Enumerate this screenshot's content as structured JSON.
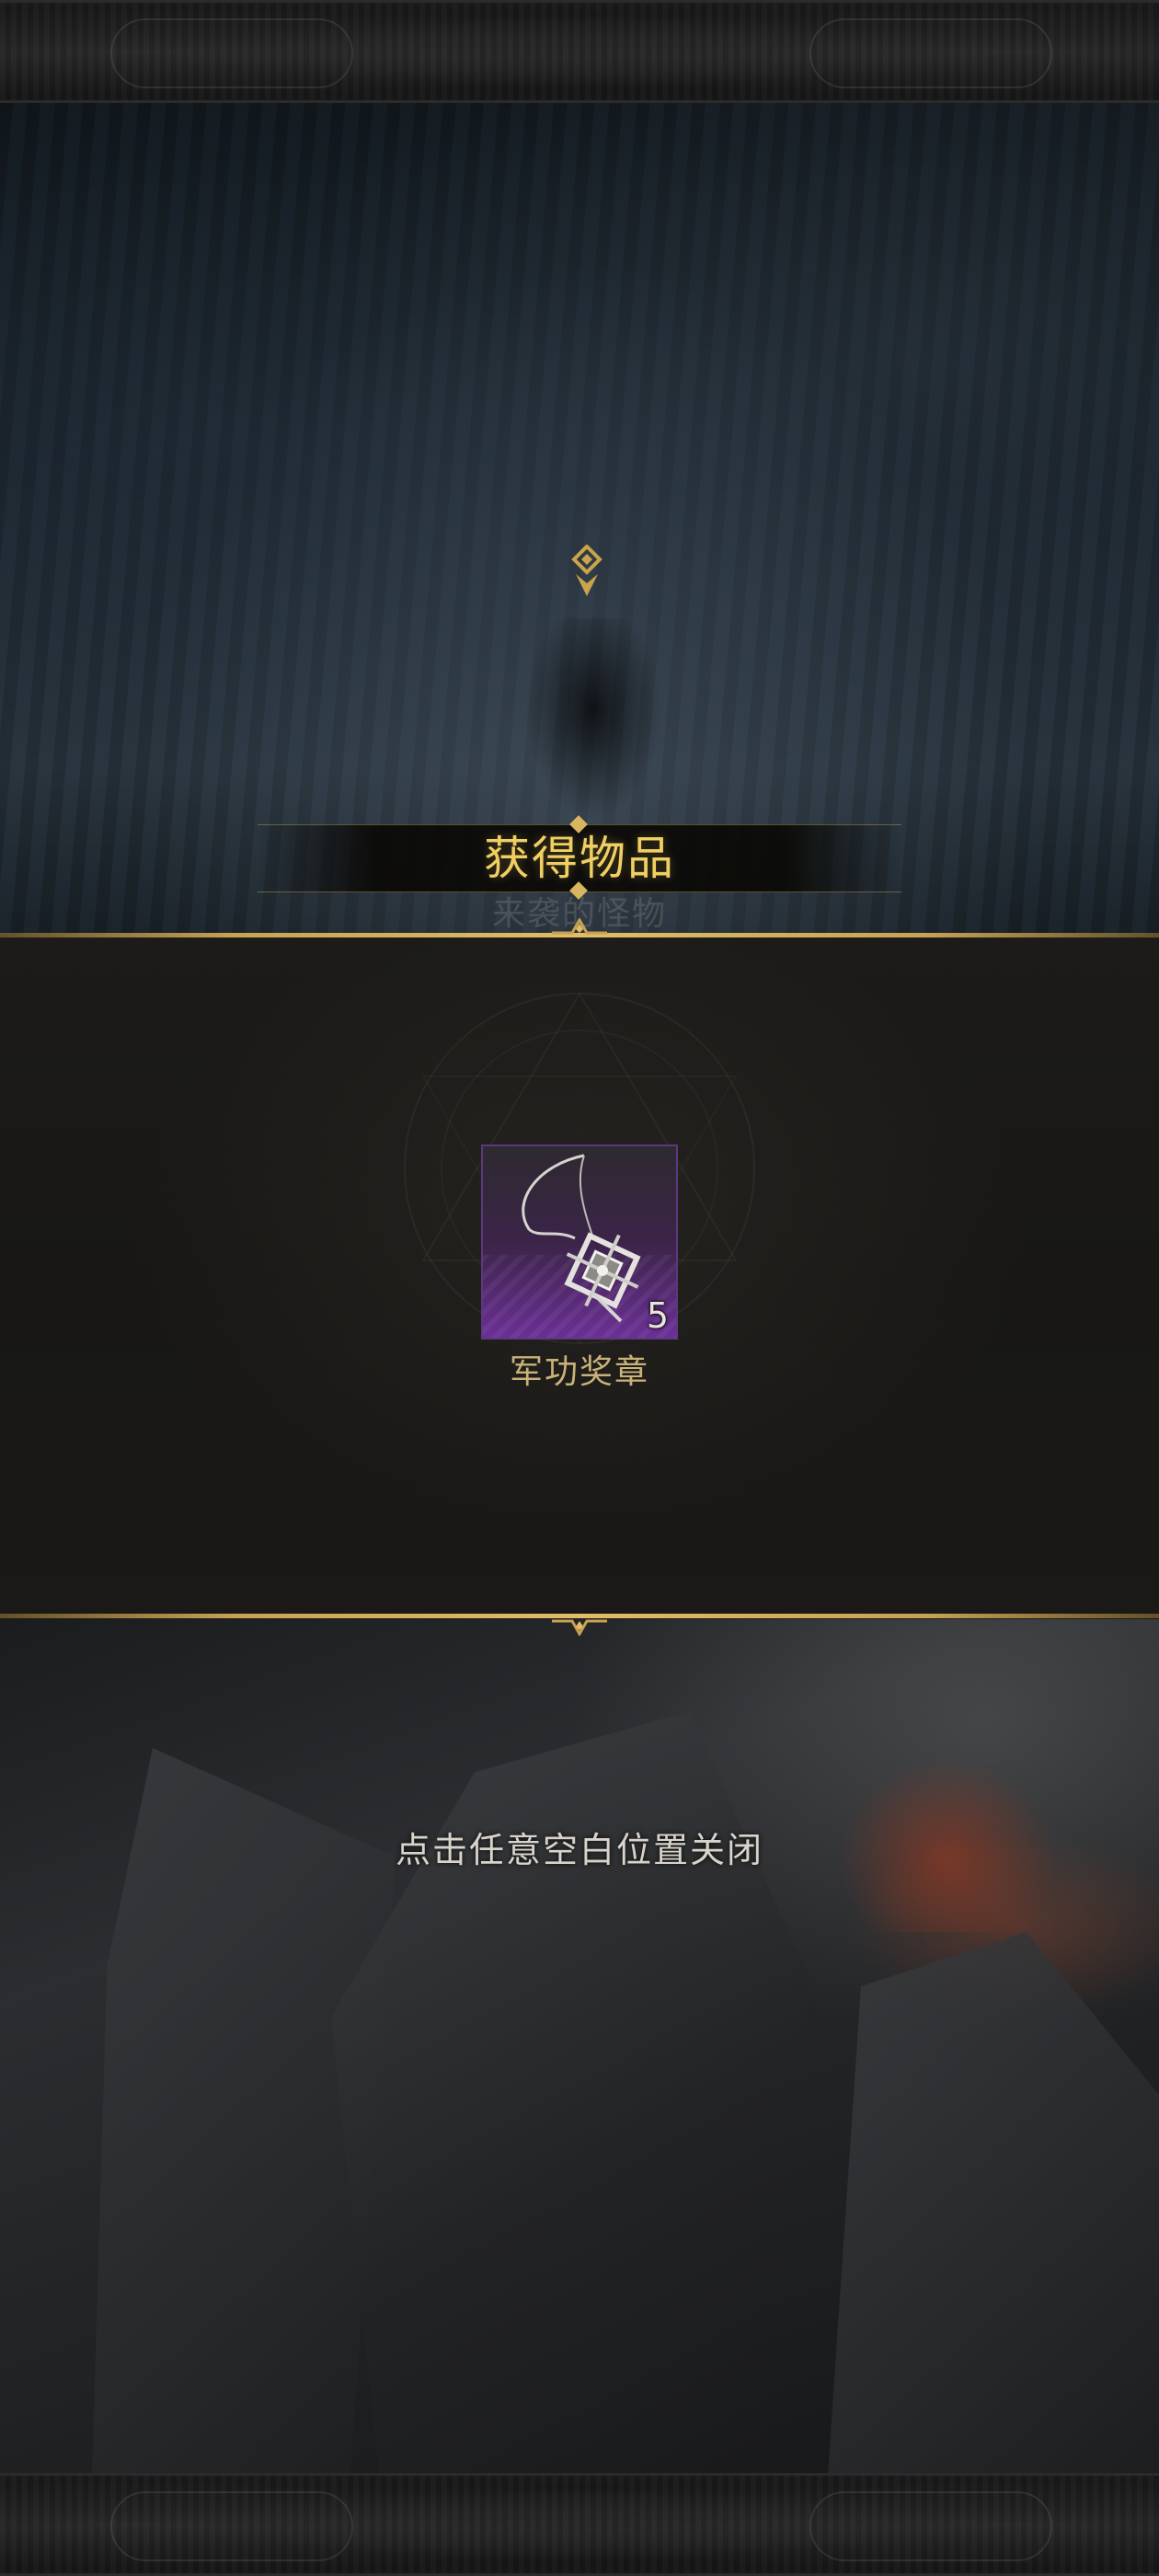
{
  "scene": {
    "label": "来袭的怪物"
  },
  "dialog": {
    "title": "获得物品",
    "items": [
      {
        "name": "军功奖章",
        "count": "5",
        "rarity": "purple",
        "icon": "medal-icon"
      }
    ],
    "close_hint": "点击任意空白位置关闭"
  },
  "colors": {
    "title": "#f0cf62",
    "gold_line": "#c7a253",
    "item_name": "#c9b27a",
    "rarity_purple": "#6b2f96",
    "hint": "#d8d4cc"
  }
}
